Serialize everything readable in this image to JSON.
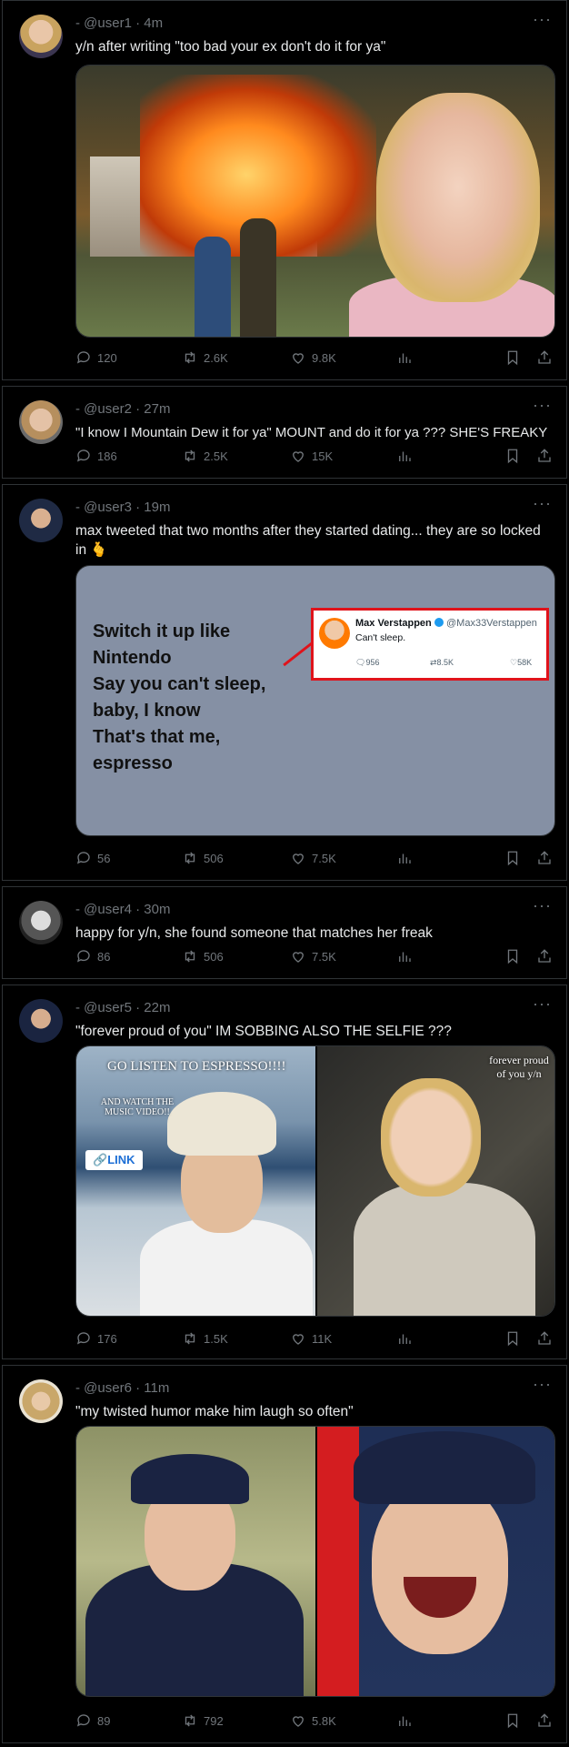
{
  "posts": [
    {
      "user": "@user1",
      "time": "4m",
      "text": "y/n after writing \"too bad your ex don't do it for ya\"",
      "replies": "120",
      "reposts": "2.6K",
      "likes": "9.8K"
    },
    {
      "user": "@user2",
      "time": "27m",
      "text": "\"I know I Mountain Dew it for ya\" MOUNT and do it for ya ??? SHE'S FREAKY",
      "replies": "186",
      "reposts": "2.5K",
      "likes": "15K"
    },
    {
      "user": "@user3",
      "time": "19m",
      "text": "max tweeted that two months after they started dating... they are so locked in 🫰",
      "replies": "56",
      "reposts": "506",
      "likes": "7.5K",
      "card": {
        "lyrics": [
          "Switch it up like",
          "Nintendo",
          "Say you can't sleep,",
          "baby, I know",
          "That's that me,",
          "espresso"
        ],
        "embedded": {
          "name": "Max Verstappen",
          "handle": "@Max33Verstappen",
          "text": "Can't sleep.",
          "replies": "956",
          "reposts": "8.5K",
          "likes": "58K"
        }
      }
    },
    {
      "user": "@user4",
      "time": "30m",
      "text": "happy for y/n, she found someone that matches her freak",
      "replies": "86",
      "reposts": "506",
      "likes": "7.5K"
    },
    {
      "user": "@user5",
      "time": "22m",
      "text": "\"forever proud of you\" IM SOBBING ALSO THE SELFIE ???",
      "replies": "176",
      "reposts": "1.5K",
      "likes": "11K",
      "left_caption": "GO LISTEN TO ESPRESSO!!!!",
      "left_sub": "AND WATCH THE MUSIC VIDEO!!",
      "link_label": "LINK",
      "right_caption": "forever proud of you y/n"
    },
    {
      "user": "@user6",
      "time": "11m",
      "text": "\"my twisted humor make him laugh so often\"",
      "replies": "89",
      "reposts": "792",
      "likes": "5.8K"
    }
  ],
  "separator": "-",
  "dot": "·",
  "more": "···",
  "colors": {
    "background": "#000000",
    "text": "#e7e9ea",
    "muted": "#71767b",
    "border": "#2f3336",
    "highlight": "#e0131b"
  }
}
